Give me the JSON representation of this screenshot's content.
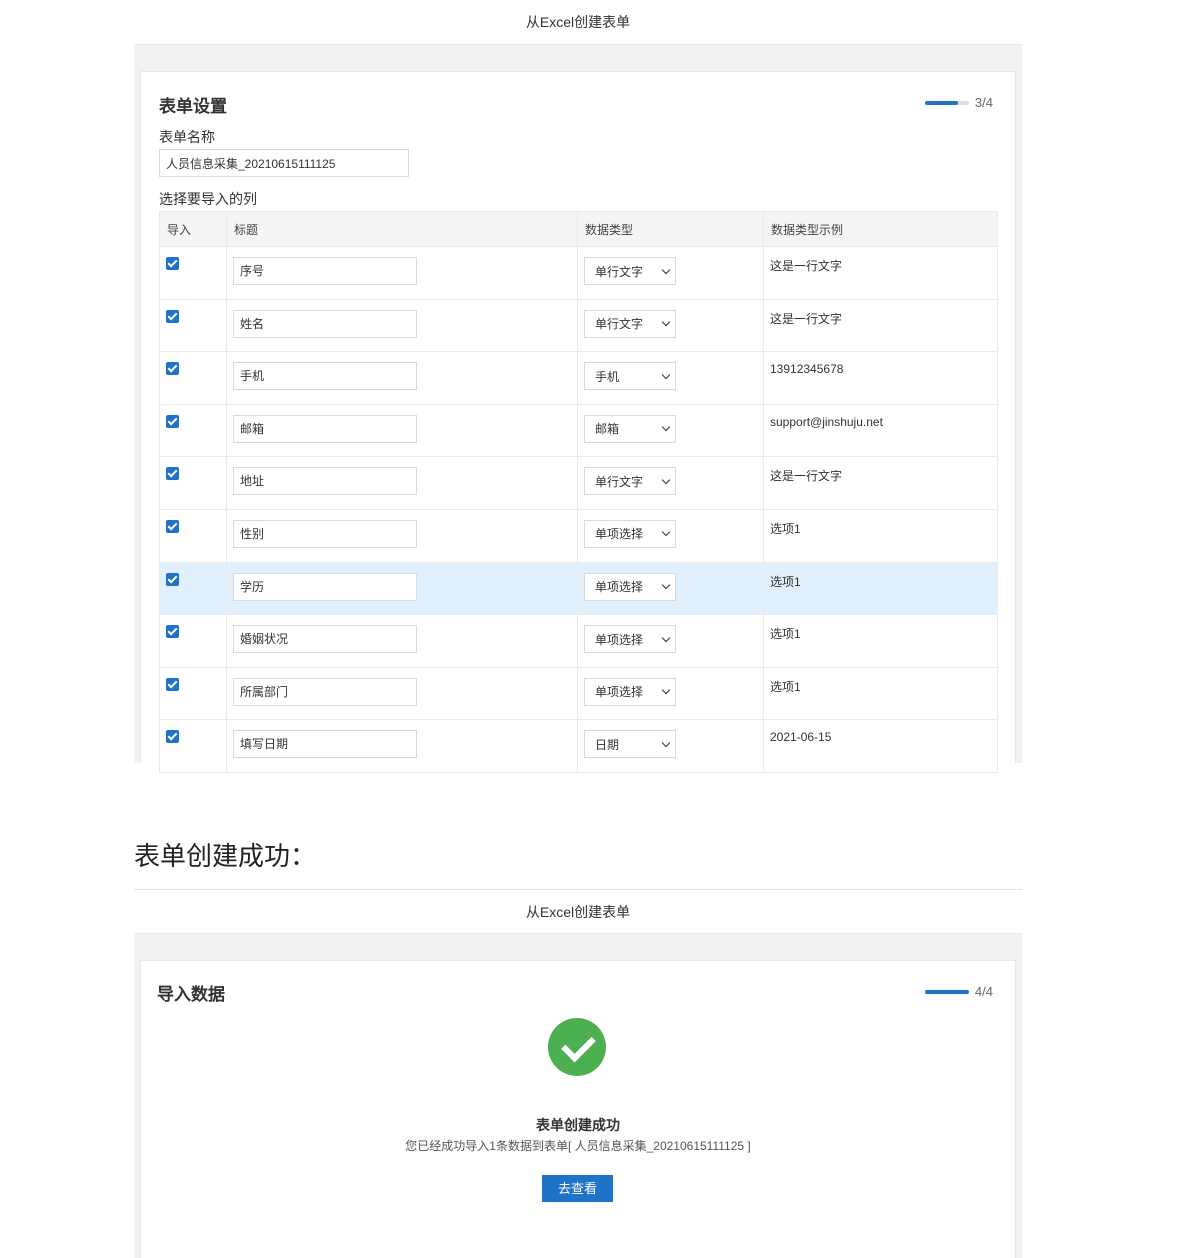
{
  "screen1": {
    "topbar_title": "从Excel创建表单",
    "card_title": "表单设置",
    "progress_text": "3/4",
    "progress_fraction": 0.75,
    "form_name_label": "表单名称",
    "form_name_value": "人员信息采集_20210615111125",
    "columns_label": "选择要导入的列",
    "table": {
      "headers": [
        "导入",
        "标题",
        "数据类型",
        "数据类型示例"
      ],
      "rows": [
        {
          "checked": true,
          "title": "序号",
          "type": "单行文字",
          "example": "这是一行文字"
        },
        {
          "checked": true,
          "title": "姓名",
          "type": "单行文字",
          "example": "这是一行文字"
        },
        {
          "checked": true,
          "title": "手机",
          "type": "手机",
          "example": "13912345678"
        },
        {
          "checked": true,
          "title": "邮箱",
          "type": "邮箱",
          "example": "support@jinshuju.net"
        },
        {
          "checked": true,
          "title": "地址",
          "type": "单行文字",
          "example": "这是一行文字"
        },
        {
          "checked": true,
          "title": "性别",
          "type": "单项选择",
          "example": "选项1"
        },
        {
          "checked": true,
          "title": "学历",
          "type": "单项选择",
          "example": "选项1",
          "highlighted": true
        },
        {
          "checked": true,
          "title": "婚姻状况",
          "type": "单项选择",
          "example": "选项1"
        },
        {
          "checked": true,
          "title": "所属部门",
          "type": "单项选择",
          "example": "选项1"
        },
        {
          "checked": true,
          "title": "填写日期",
          "type": "日期",
          "example": "2021-06-15"
        }
      ]
    }
  },
  "section_heading": "表单创建成功：",
  "screen2": {
    "topbar_title": "从Excel创建表单",
    "card_title": "导入数据",
    "progress_text": "4/4",
    "progress_fraction": 1.0,
    "success_title": "表单创建成功",
    "success_message": "您已经成功导入1条数据到表单[ 人员信息采集_20210615111125 ]",
    "view_button_label": "去查看"
  },
  "colors": {
    "accent": "#1e72c7",
    "success": "#4caf50",
    "highlight_row": "#dff0fc"
  }
}
